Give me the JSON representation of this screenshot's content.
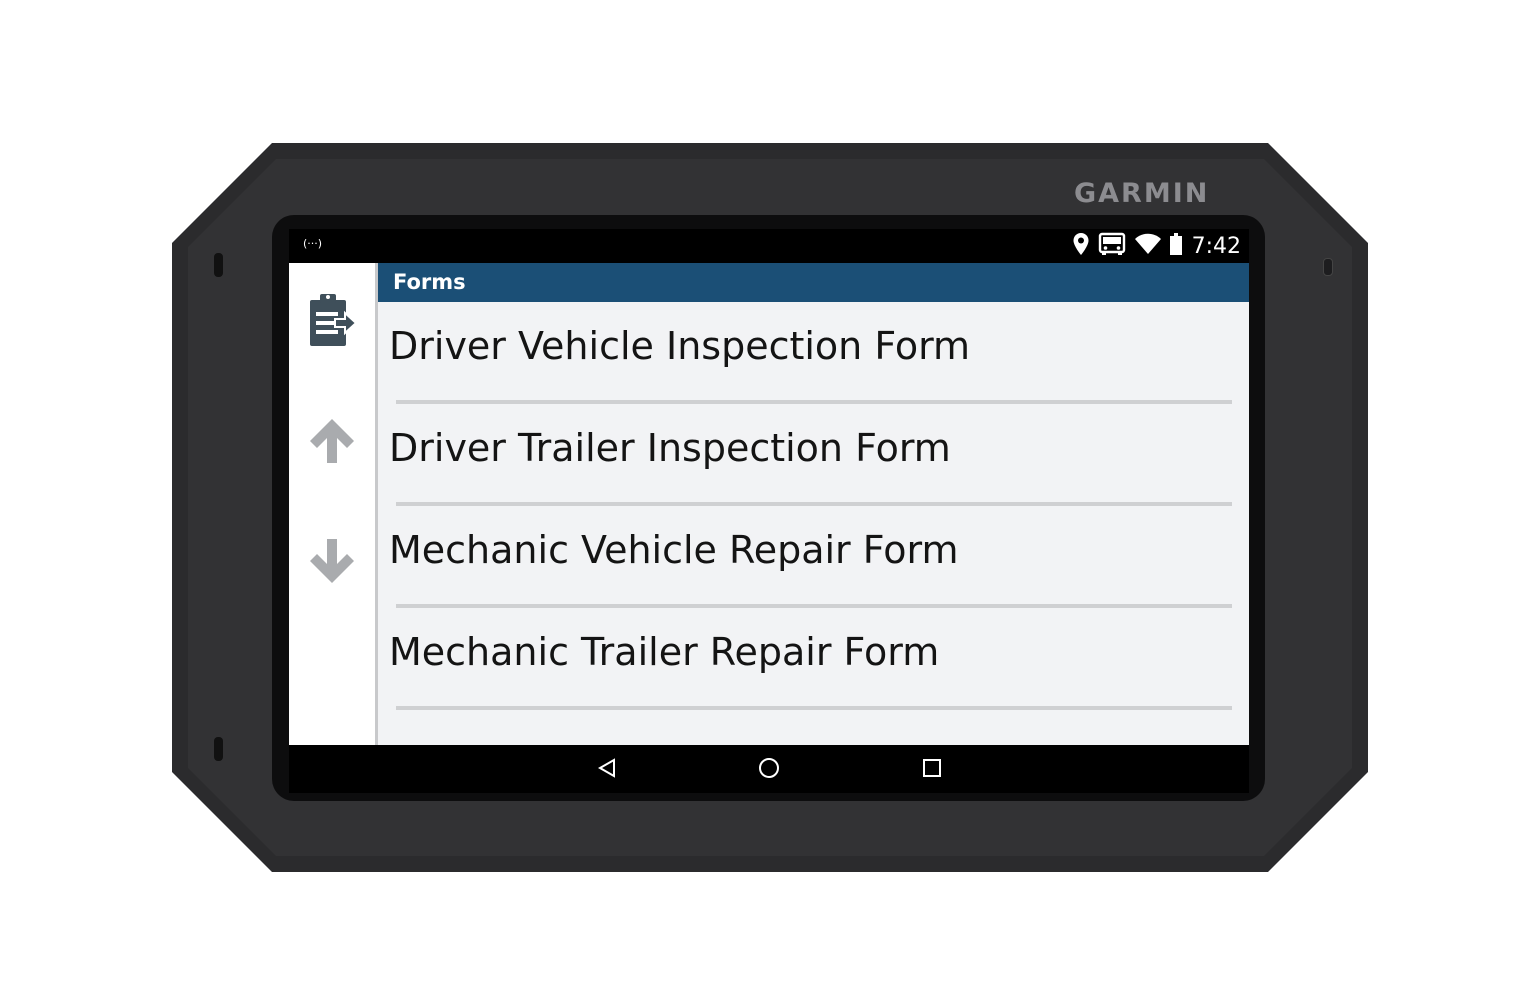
{
  "device": {
    "brand": "GARMIN"
  },
  "statusbar": {
    "left_indicator": "(···)",
    "time": "7:42",
    "icons": [
      "location-pin-icon",
      "truck-icon",
      "wifi-icon",
      "battery-icon"
    ]
  },
  "sidebar": {
    "icons": [
      "forms-clipboard-icon",
      "scroll-up-arrow-icon",
      "scroll-down-arrow-icon"
    ]
  },
  "main": {
    "title": "Forms",
    "items": [
      {
        "label": "Driver Vehicle Inspection Form"
      },
      {
        "label": "Driver Trailer Inspection Form"
      },
      {
        "label": "Mechanic Vehicle Repair Form"
      },
      {
        "label": "Mechanic Trailer Repair Form"
      }
    ]
  },
  "navbar": {
    "icons": [
      "back-icon",
      "home-icon",
      "recent-apps-icon"
    ]
  },
  "colors": {
    "title_bar": "#1b4f76",
    "content_bg": "#f2f3f5",
    "divider": "#cfd0d2",
    "arrow_gray": "#a9abae"
  }
}
